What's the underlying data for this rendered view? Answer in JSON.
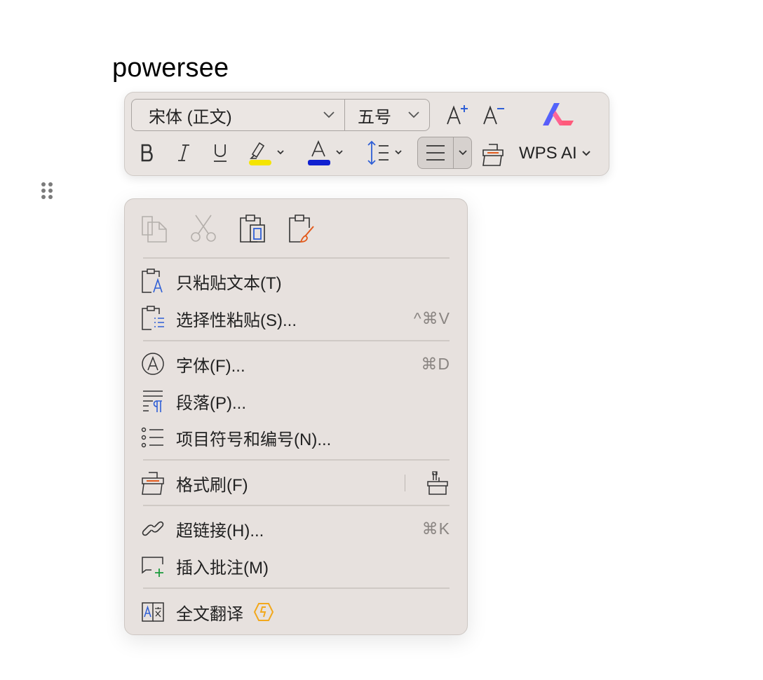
{
  "document": {
    "text": "powersee"
  },
  "toolbar": {
    "font_name": "宋体 (正文)",
    "font_size": "五号",
    "increase_font_icon": "font-increase-icon",
    "decrease_font_icon": "font-decrease-icon",
    "bold_icon": "bold-icon",
    "italic_icon": "italic-icon",
    "underline_icon": "underline-icon",
    "highlight_color": "#f5e400",
    "font_color": "#1020d0",
    "wps_ai_label": "WPS AI"
  },
  "context_menu": {
    "clipboard_icons": [
      "copy-icon",
      "cut-icon",
      "paste-keep-format-icon",
      "paste-merge-format-icon"
    ],
    "items": [
      {
        "label": "只粘贴文本(T)",
        "shortcut": ""
      },
      {
        "label": "选择性粘贴(S)...",
        "shortcut": "^⌘V"
      },
      {
        "label": "字体(F)...",
        "shortcut": "⌘D"
      },
      {
        "label": "段落(P)...",
        "shortcut": ""
      },
      {
        "label": "项目符号和编号(N)...",
        "shortcut": ""
      },
      {
        "label": "格式刷(F)",
        "shortcut": ""
      },
      {
        "label": "超链接(H)...",
        "shortcut": "⌘K"
      },
      {
        "label": "插入批注(M)",
        "shortcut": ""
      },
      {
        "label": "全文翻译",
        "shortcut": ""
      }
    ]
  },
  "colors": {
    "menu_bg": "#e7e1de",
    "toolbar_bg": "#e9e4e1",
    "accent_blue": "#2f5fd6",
    "accent_orange": "#e25a1c",
    "premium_gold": "#f2a81d"
  }
}
